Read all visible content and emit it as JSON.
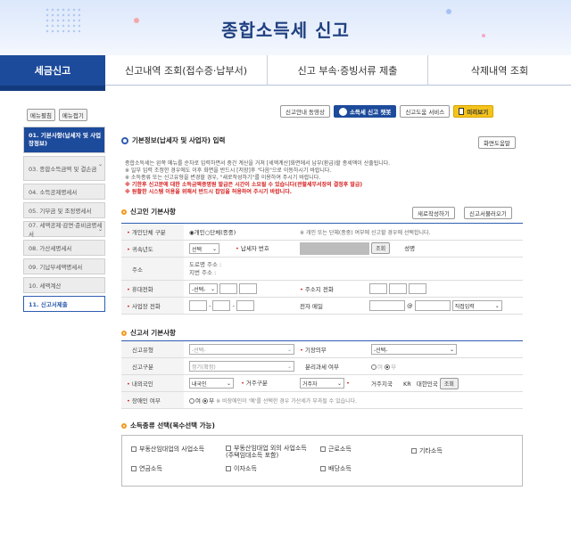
{
  "header": {
    "title": "종합소득세 신고"
  },
  "tabs": [
    "세금신고",
    "신고내역 조회(접수증·납부서)",
    "신고 부속·증빙서류 제출",
    "삭제내역 조회"
  ],
  "sidebar": {
    "top_buttons": [
      "메뉴펼침",
      "메뉴접기"
    ],
    "items": [
      "01. 기본사항(납세자 및 사업장정보)",
      "03. 종합소득금액 및 결손금",
      "04. 소득공제명세서",
      "05. 기부금 및 조정명세서",
      "07. 세액공제·감면·준비금명세서",
      "08. 가산세명세서",
      "09. 기납부세액명세서",
      "10. 세액계산",
      "11. 신고서제출"
    ]
  },
  "toolbar": {
    "video": "신고안내 동영상",
    "chatbot": "소득세 신고 챗봇",
    "service": "신고도움 서비스",
    "preview": "미리보기"
  },
  "section1": {
    "title": "기본정보(납세자 및 사업자) 입력",
    "guide_btn": "화면도움말"
  },
  "notes": [
    {
      "t": "종합소득세는 왼쪽 메뉴를 순차로 입력하면서 중간 계산을 거쳐 [세액계산]화면에서 납부(환급)할 종세액이 산출됩니다.",
      "c": "g"
    },
    {
      "t": "※ 일부 입력 조정한 경우에도 이후 화면을 반드시 [저장]후 \"다음\"으로 이동하시기 바랍니다.",
      "c": "g"
    },
    {
      "t": "※ 소득종류 또는 신고유형을 변경할 경우, \"새로작성하기\"를 이용하여 주시기 바랍니다.",
      "c": "g"
    },
    {
      "t": "※ 기한후 신고분에 대한 소득금액증명원 발급은 시간이 소요될 수 있습니다(관할세무서장의 결정후 발급)",
      "c": "r"
    },
    {
      "t": "※ 원활한 시스템 이용을 위해서 반드시 팝업을 허용하여 주시기 바랍니다.",
      "c": "r"
    }
  ],
  "basic": {
    "title": "신고인 기본사항",
    "new_btn": "새로작성하기",
    "load_btn": "신고서불러오기",
    "type_label": "개인단체 구분",
    "type_value": "◉개인○단체(종중)",
    "type_note": "※ 개인 또는 단체(종중) 여부에 신고할 경우에 선택합니다.",
    "year_label": "귀속년도",
    "year_value": "선택",
    "tin_label": "납세자 번호",
    "query": "조회",
    "name_label": "성명",
    "addr_label": "주소",
    "addr1": "도로명 주소 :",
    "addr2": "지번 주소 :",
    "mobile_label": "휴대전화",
    "mobile_sel": "-선택-",
    "home_label": "주소지 전화",
    "biz_label": "사업장 전화",
    "email_label": "전자 메일",
    "email_at": "@",
    "email_sel": "직접입력"
  },
  "report": {
    "title": "신고서 기본사항",
    "type_label": "신고유형",
    "type_val": "-선택-",
    "duty_label": "기장의무",
    "duty_val": "-선택-",
    "kind_label": "신고구분",
    "kind_val": "정기(확정)",
    "sep_label": "분리과세 여부",
    "sep_yes": "여",
    "sep_no": "부",
    "nat_label": "내외국인",
    "nat_val": "내국인",
    "res_label": "거주구분",
    "res_val": "거주자",
    "country_label": "거주지국",
    "country_code": "KR",
    "country_name": "대한민국",
    "country_btn": "조회",
    "dis_label": "장애인 여부",
    "dis_yes": "여",
    "dis_no": "부",
    "dis_note": "※ 비장애인이 '예'를 선택한 경우 가산세가 부과될 수 있습니다."
  },
  "income": {
    "title": "소득종류 선택(복수선택 가능)",
    "items": [
      "부동산임대업의 사업소득",
      "부동산임대업 외의 사업소득\n(주택임대소득 포함)",
      "근로소득",
      "기타소득",
      "연금소득",
      "이자소득",
      "배당소득"
    ]
  }
}
